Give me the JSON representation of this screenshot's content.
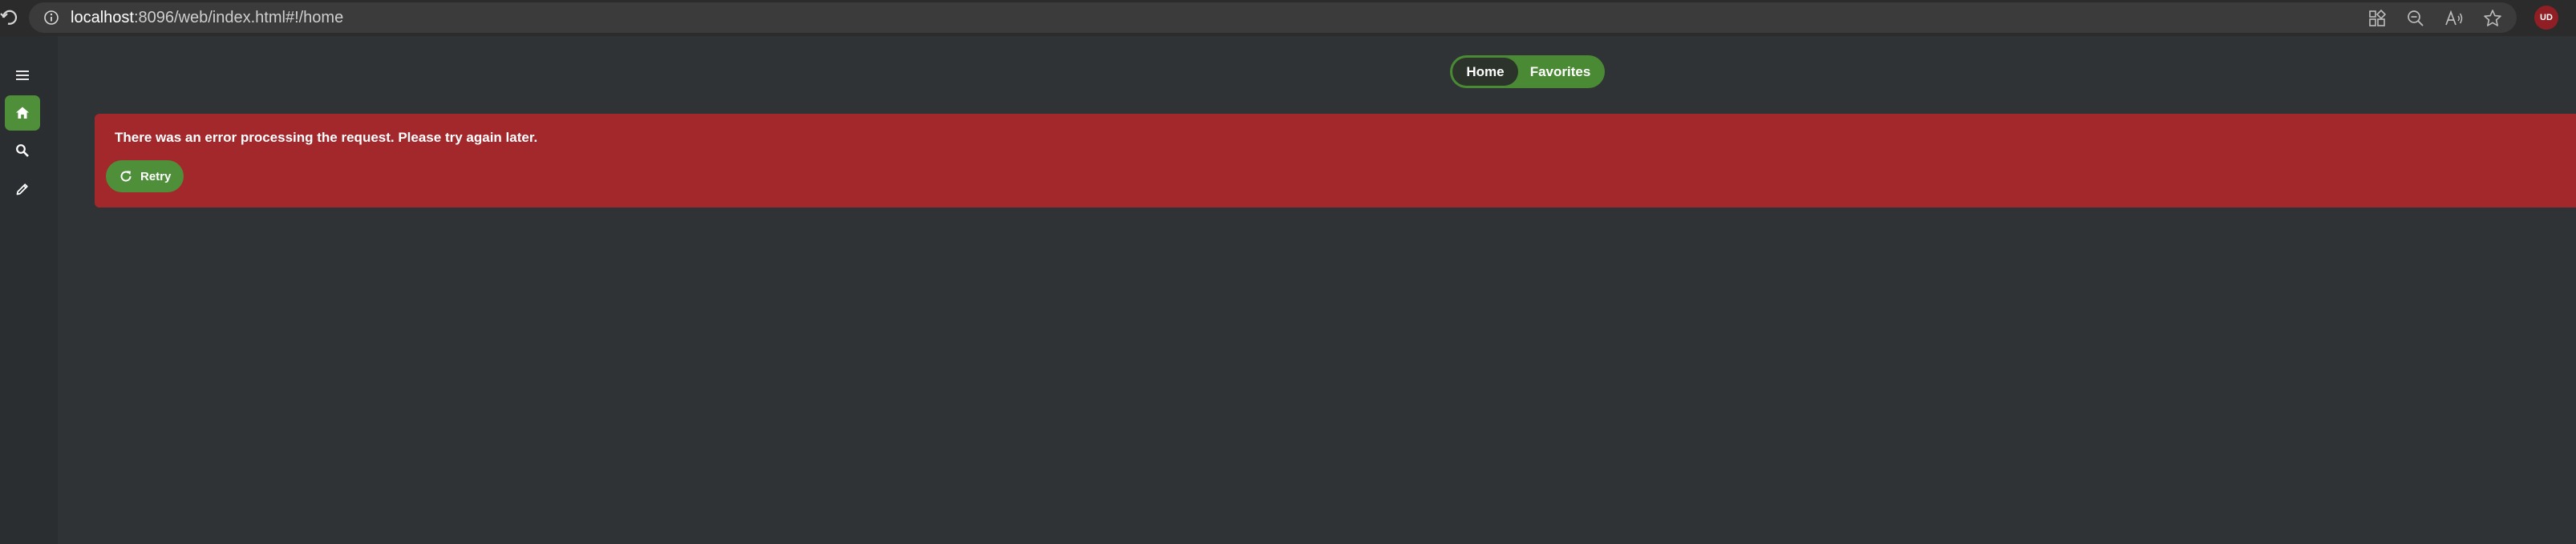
{
  "browser": {
    "url_host": "localhost",
    "url_rest": ":8096/web/index.html#!/home",
    "extension_badge": "UD"
  },
  "rail": {
    "items": [
      {
        "icon": "menu-icon"
      },
      {
        "icon": "home-icon",
        "active": true
      },
      {
        "icon": "search-icon"
      },
      {
        "icon": "edit-icon"
      }
    ]
  },
  "tabs": [
    {
      "label": "Home",
      "active": true
    },
    {
      "label": "Favorites",
      "active": false
    }
  ],
  "error": {
    "message": "There was an error processing the request. Please try again later.",
    "retry_label": "Retry"
  },
  "colors": {
    "accent": "#4f8f3a",
    "error": "#a3282c",
    "background": "#2f3336"
  }
}
